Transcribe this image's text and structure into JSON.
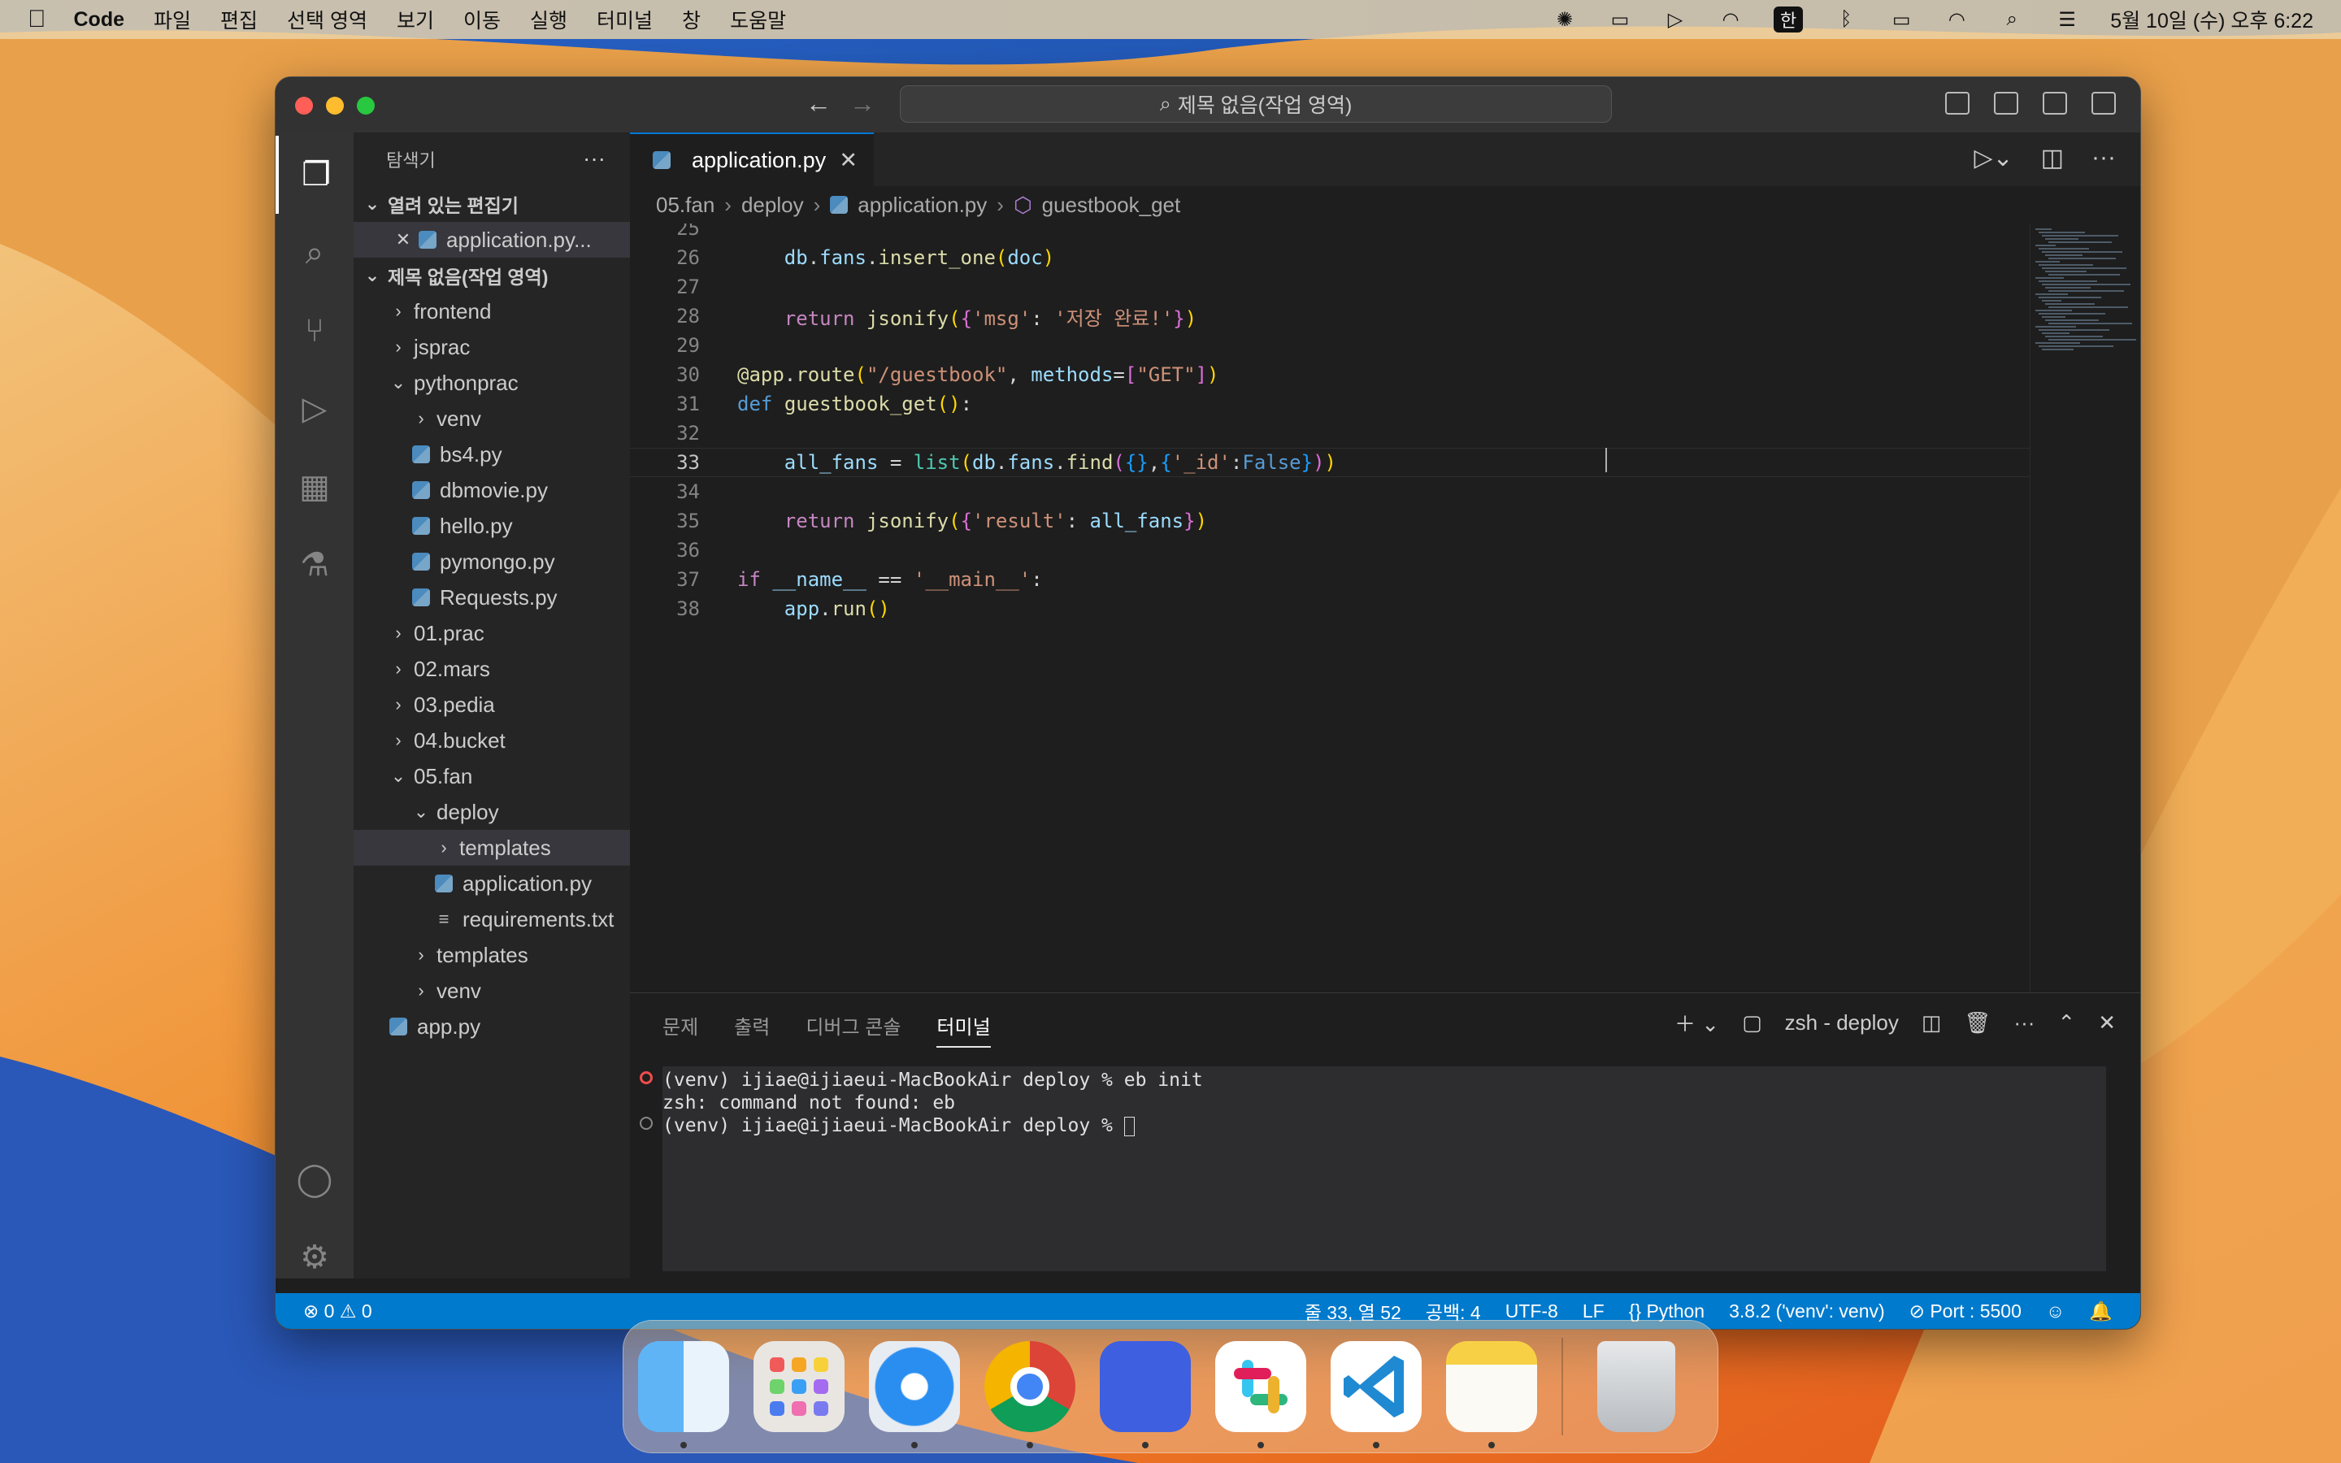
{
  "menubar": {
    "app": "Code",
    "items": [
      "파일",
      "편집",
      "선택 영역",
      "보기",
      "이동",
      "실행",
      "터미널",
      "창",
      "도움말"
    ],
    "han_label": "한",
    "datetime": "5월 10일 (수) 오후 6:22"
  },
  "window": {
    "search_text": "제목 없음(작업 영역)"
  },
  "sidebar": {
    "title": "탐색기",
    "open_editors_label": "열려 있는 편집기",
    "open_editor_file": "application.py...",
    "workspace_label": "제목 없음(작업 영역)",
    "tree": [
      {
        "label": "frontend",
        "kind": "folder",
        "level": 1,
        "open": false
      },
      {
        "label": "jsprac",
        "kind": "folder",
        "level": 1,
        "open": false
      },
      {
        "label": "pythonprac",
        "kind": "folder",
        "level": 1,
        "open": true
      },
      {
        "label": "venv",
        "kind": "folder",
        "level": 2,
        "open": false
      },
      {
        "label": "bs4.py",
        "kind": "py",
        "level": 2
      },
      {
        "label": "dbmovie.py",
        "kind": "py",
        "level": 2
      },
      {
        "label": "hello.py",
        "kind": "py",
        "level": 2
      },
      {
        "label": "pymongo.py",
        "kind": "py",
        "level": 2
      },
      {
        "label": "Requests.py",
        "kind": "py",
        "level": 2
      },
      {
        "label": "01.prac",
        "kind": "folder",
        "level": 1,
        "open": false
      },
      {
        "label": "02.mars",
        "kind": "folder",
        "level": 1,
        "open": false
      },
      {
        "label": "03.pedia",
        "kind": "folder",
        "level": 1,
        "open": false
      },
      {
        "label": "04.bucket",
        "kind": "folder",
        "level": 1,
        "open": false
      },
      {
        "label": "05.fan",
        "kind": "folder",
        "level": 1,
        "open": true
      },
      {
        "label": "deploy",
        "kind": "folder",
        "level": 2,
        "open": true
      },
      {
        "label": "templates",
        "kind": "folder",
        "level": 3,
        "open": false,
        "selected": true
      },
      {
        "label": "application.py",
        "kind": "py",
        "level": 3
      },
      {
        "label": "requirements.txt",
        "kind": "txt",
        "level": 3
      },
      {
        "label": "templates",
        "kind": "folder",
        "level": 2,
        "open": false
      },
      {
        "label": "venv",
        "kind": "folder",
        "level": 2,
        "open": false
      },
      {
        "label": "app.py",
        "kind": "py",
        "level": 1
      }
    ]
  },
  "editor": {
    "tab_label": "application.py",
    "breadcrumb": [
      "05.fan",
      "deploy",
      "application.py",
      "guestbook_get"
    ],
    "lines": [
      {
        "n": "25",
        "html": ""
      },
      {
        "n": "26",
        "html": "    <span class='var'>db</span>.<span class='var'>fans</span>.<span class='fn'>insert_one</span><span class='br1'>(</span><span class='var'>doc</span><span class='br1'>)</span>"
      },
      {
        "n": "27",
        "html": ""
      },
      {
        "n": "28",
        "html": "    <span class='kw2'>return</span> <span class='fn'>jsonify</span><span class='br1'>(</span><span class='br2'>{</span><span class='str'>'msg'</span>: <span class='str'>'저장 완료!'</span><span class='br2'>}</span><span class='br1'>)</span>"
      },
      {
        "n": "29",
        "html": ""
      },
      {
        "n": "30",
        "html": "<span class='fn'>@app</span>.<span class='fn'>route</span><span class='br1'>(</span><span class='str'>\"/guestbook\"</span>, <span class='var'>methods</span>=<span class='br2'>[</span><span class='str'>\"GET\"</span><span class='br2'>]</span><span class='br1'>)</span>"
      },
      {
        "n": "31",
        "html": "<span class='kw'>def</span> <span class='fn'>guestbook_get</span><span class='br1'>()</span>:"
      },
      {
        "n": "32",
        "html": ""
      },
      {
        "n": "33",
        "html": "    <span class='var'>all_fans</span> = <span class='bi'>list</span><span class='br1'>(</span><span class='var'>db</span>.<span class='var'>fans</span>.<span class='fn'>find</span><span class='br2'>(</span><span class='br3'>{}</span>,<span class='br3'>{</span><span class='str'>'_id'</span>:<span class='kw'>False</span><span class='br3'>}</span><span class='br2'>)</span><span class='br1'>)</span>",
        "current": true
      },
      {
        "n": "34",
        "html": ""
      },
      {
        "n": "35",
        "html": "    <span class='kw2'>return</span> <span class='fn'>jsonify</span><span class='br1'>(</span><span class='br2'>{</span><span class='str'>'result'</span>: <span class='var'>all_fans</span><span class='br2'>}</span><span class='br1'>)</span>"
      },
      {
        "n": "36",
        "html": ""
      },
      {
        "n": "37",
        "html": "<span class='kw2'>if</span> <span class='var'>__name__</span> == <span class='str'>'__main__'</span>:"
      },
      {
        "n": "38",
        "html": "    <span class='var'>app</span>.<span class='fn'>run</span><span class='br1'>()</span>"
      }
    ]
  },
  "panel": {
    "tabs": [
      "문제",
      "출력",
      "디버그 콘솔",
      "터미널"
    ],
    "active_tab": "터미널",
    "terminal_name": "zsh - deploy",
    "terminal_lines": [
      {
        "text": "(venv) ijiae@ijiaeui-MacBookAir deploy % eb init",
        "mark": "error"
      },
      {
        "text": "zsh: command not found: eb",
        "mark": "none"
      },
      {
        "text": "(venv) ijiae@ijiaeui-MacBookAir deploy % ",
        "mark": "circle"
      }
    ]
  },
  "statusbar": {
    "problems": "⊗ 0 ⚠ 0",
    "cursor": "줄 33, 열 52",
    "indent": "공백: 4",
    "encoding": "UTF-8",
    "eol": "LF",
    "language": "Python",
    "interpreter": "3.8.2 ('venv': venv)",
    "port": "Port : 5500"
  },
  "colors": {
    "accent": "#007acc",
    "keyword": "#569cd6",
    "string": "#ce9178",
    "function": "#dcdcaa"
  }
}
